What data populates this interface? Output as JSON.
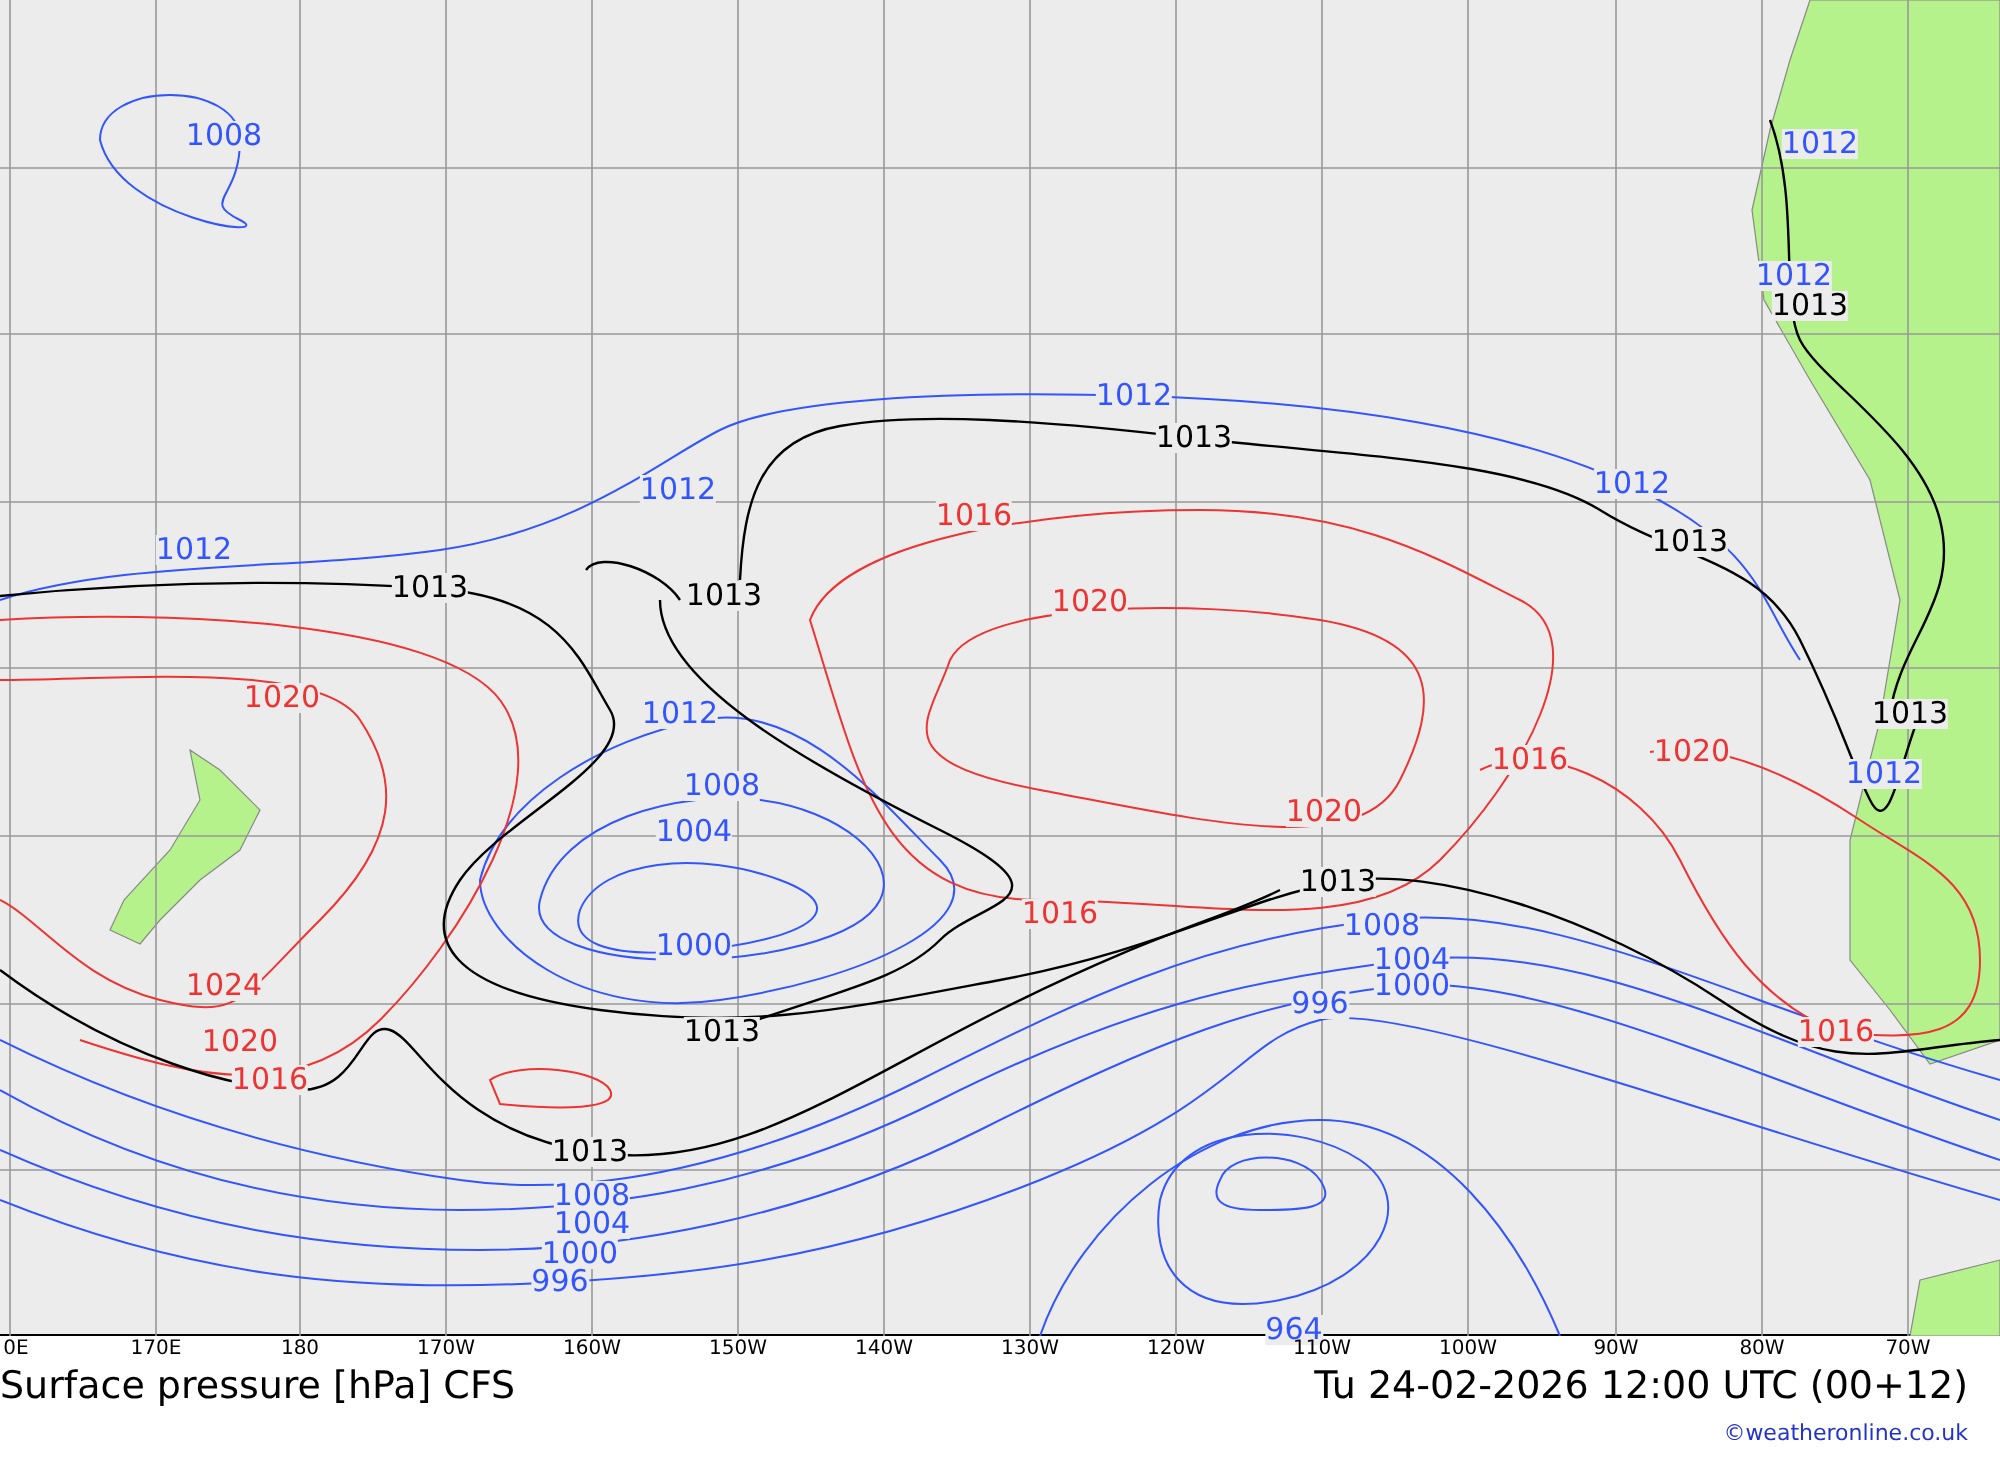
{
  "map": {
    "isobar_labels": [
      {
        "text": "1008",
        "kind": "low"
      },
      {
        "text": "1012",
        "kind": "low"
      },
      {
        "text": "1012",
        "kind": "low"
      },
      {
        "text": "1013",
        "kind": "mean"
      },
      {
        "text": "1012",
        "kind": "low"
      },
      {
        "text": "1013",
        "kind": "mean"
      },
      {
        "text": "1012",
        "kind": "low"
      },
      {
        "text": "1012",
        "kind": "low"
      },
      {
        "text": "1016",
        "kind": "high"
      },
      {
        "text": "1013",
        "kind": "mean"
      },
      {
        "text": "1012",
        "kind": "low"
      },
      {
        "text": "1013",
        "kind": "mean"
      },
      {
        "text": "1013",
        "kind": "mean"
      },
      {
        "text": "1020",
        "kind": "high"
      },
      {
        "text": "1020",
        "kind": "high"
      },
      {
        "text": "1012",
        "kind": "low"
      },
      {
        "text": "1013",
        "kind": "mean"
      },
      {
        "text": "1016",
        "kind": "high"
      },
      {
        "text": "1020",
        "kind": "high"
      },
      {
        "text": "1012",
        "kind": "low"
      },
      {
        "text": "1008",
        "kind": "low"
      },
      {
        "text": "1020",
        "kind": "high"
      },
      {
        "text": "1004",
        "kind": "low"
      },
      {
        "text": "1013",
        "kind": "mean"
      },
      {
        "text": "1016",
        "kind": "high"
      },
      {
        "text": "1008",
        "kind": "low"
      },
      {
        "text": "1000",
        "kind": "low"
      },
      {
        "text": "1004",
        "kind": "low"
      },
      {
        "text": "1024",
        "kind": "high"
      },
      {
        "text": "1000",
        "kind": "low"
      },
      {
        "text": "996",
        "kind": "low"
      },
      {
        "text": "1013",
        "kind": "mean"
      },
      {
        "text": "1020",
        "kind": "high"
      },
      {
        "text": "1016",
        "kind": "high"
      },
      {
        "text": "1016",
        "kind": "high"
      },
      {
        "text": "1013",
        "kind": "mean"
      },
      {
        "text": "1008",
        "kind": "low"
      },
      {
        "text": "1004",
        "kind": "low"
      },
      {
        "text": "1000",
        "kind": "low"
      },
      {
        "text": "996",
        "kind": "low"
      },
      {
        "text": "964",
        "kind": "low"
      }
    ],
    "longitude_labels": [
      "0E",
      "170E",
      "180",
      "170W",
      "160W",
      "150W",
      "140W",
      "130W",
      "120W",
      "110W",
      "100W",
      "90W",
      "80W",
      "70W"
    ]
  },
  "title": "Surface pressure [hPa] CFS",
  "valid_time": "Tu 24-02-2026 12:00 UTC (00+12)",
  "credit": "©weatheronline.co.uk"
}
